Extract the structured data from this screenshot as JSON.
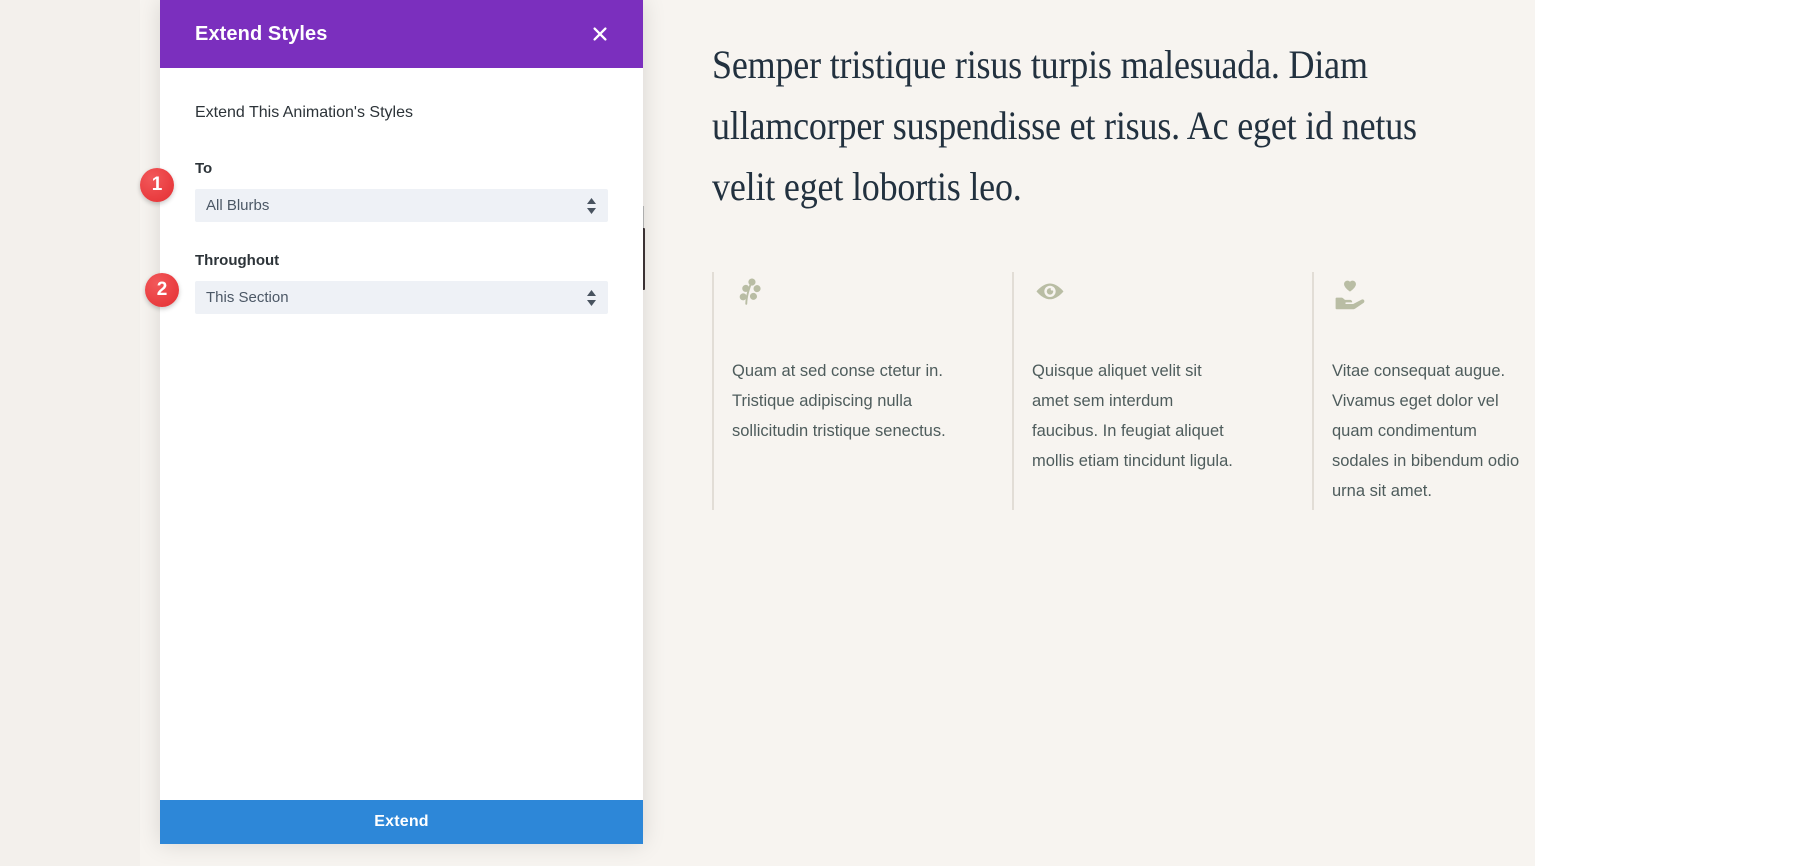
{
  "modal": {
    "title": "Extend Styles",
    "close_icon": "close-icon",
    "section_label": "Extend This Animation's Styles",
    "fields": [
      {
        "label": "To",
        "value": "All Blurbs",
        "step": "1"
      },
      {
        "label": "Throughout",
        "value": "This Section",
        "step": "2"
      }
    ],
    "submit_label": "Extend",
    "colors": {
      "header": "#7b2fbe",
      "submit": "#2d87d8",
      "badge": "#ea3f42",
      "select_bg": "#eef1f6"
    }
  },
  "steps": [
    {
      "number": "1"
    },
    {
      "number": "2"
    }
  ],
  "content": {
    "heading": "Semper tristique risus turpis malesuada. Diam ullamcorper suspendisse et risus. Ac eget id netus velit eget lobortis leo.",
    "blurbs": [
      {
        "icon": "leaf-branch-icon",
        "text": "Quam at sed conse ctetur in. Tristique adipiscing nulla sollicitudin tristique senectus."
      },
      {
        "icon": "eye-icon",
        "text": "Quisque aliquet velit sit amet sem interdum faucibus. In feugiat aliquet mollis etiam tincidunt ligula."
      },
      {
        "icon": "heart-in-hand-icon",
        "text": "Vitae consequat augue. Vivamus eget dolor vel quam condimentum sodales in bibendum odio urna sit amet."
      }
    ],
    "colors": {
      "background": "#f7f4f0",
      "heading": "#22313f",
      "body_text": "#4e5c5c",
      "icon": "#b9bda4",
      "divider": "#e2ddd6"
    }
  }
}
